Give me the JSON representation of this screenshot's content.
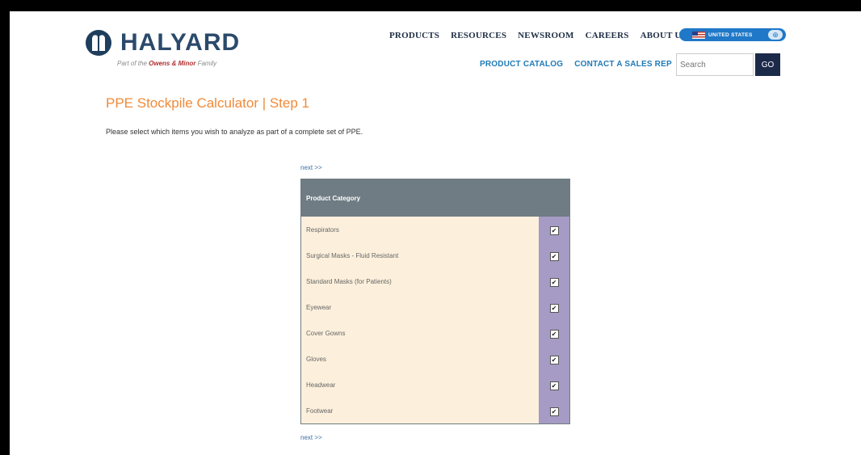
{
  "header": {
    "logo_text": "HALYARD",
    "logo_sub_prefix": "Part of the ",
    "logo_sub_brand": "Owens & Minor",
    "logo_sub_suffix": " Family",
    "nav": [
      "PRODUCTS",
      "RESOURCES",
      "NEWSROOM",
      "CAREERS",
      "ABOUT US"
    ],
    "country": "UNITED STATES",
    "subnav": [
      "PRODUCT CATALOG",
      "CONTACT A SALES REP"
    ],
    "search_placeholder": "Search",
    "go_label": "GO"
  },
  "main": {
    "title": "PPE Stockpile Calculator | Step 1",
    "intro": "Please select which items you wish to analyze as part of a complete set of PPE.",
    "next_label": "next >>",
    "table_header": "Product Category",
    "categories": [
      {
        "label": "Respirators",
        "checked": true
      },
      {
        "label": "Surgical Masks - Fluid Resistant",
        "checked": true
      },
      {
        "label": "Standard Masks (for Patients)",
        "checked": true
      },
      {
        "label": "Eyewear",
        "checked": true
      },
      {
        "label": "Cover Gowns",
        "checked": true
      },
      {
        "label": "Gloves",
        "checked": true
      },
      {
        "label": "Headwear",
        "checked": true
      },
      {
        "label": "Footwear",
        "checked": true
      }
    ]
  },
  "colors": {
    "title_orange": "#f08a38",
    "header_gray": "#6f7c83",
    "row_cream": "#fcf0dc",
    "check_purple": "#a69bc4",
    "brand_navy": "#2b4a6b"
  }
}
